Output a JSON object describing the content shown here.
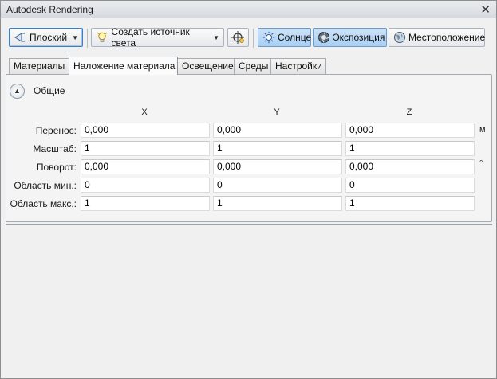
{
  "window": {
    "title": "Autodesk Rendering",
    "close_glyph": "✕"
  },
  "toolbar": {
    "projection_label": "Плоский",
    "create_light_label": "Создать источник света",
    "sun_label": "Солнце",
    "exposure_label": "Экспозиция",
    "location_label": "Местоположение"
  },
  "tabs": [
    {
      "label": "Материалы",
      "active": false
    },
    {
      "label": "Наложение материала",
      "active": true
    },
    {
      "label": "Освещение",
      "active": false
    },
    {
      "label": "Среды",
      "active": false
    },
    {
      "label": "Настройки",
      "active": false
    }
  ],
  "section": {
    "title": "Общие",
    "expanded": true
  },
  "columns": [
    "X",
    "Y",
    "Z"
  ],
  "rows": [
    {
      "label": "Перенос:",
      "values": [
        "0,000",
        "0,000",
        "0,000"
      ],
      "unit": "м"
    },
    {
      "label": "Масштаб:",
      "values": [
        "1",
        "1",
        "1"
      ],
      "unit": ""
    },
    {
      "label": "Поворот:",
      "values": [
        "0,000",
        "0,000",
        "0,000"
      ],
      "unit": "°"
    },
    {
      "label": "Область мин.:",
      "values": [
        "0",
        "0",
        "0"
      ],
      "unit": ""
    },
    {
      "label": "Область макс.:",
      "values": [
        "1",
        "1",
        "1"
      ],
      "unit": ""
    }
  ],
  "icons": {
    "projection": "plane-projection-icon",
    "create_light": "light-bulb-icon",
    "target": "target-crosshair-icon",
    "sun": "sun-icon",
    "exposure": "exposure-icon",
    "location": "globe-icon"
  },
  "colors": {
    "pressed": "#a9cff2",
    "focus": "#3c7fc4"
  }
}
